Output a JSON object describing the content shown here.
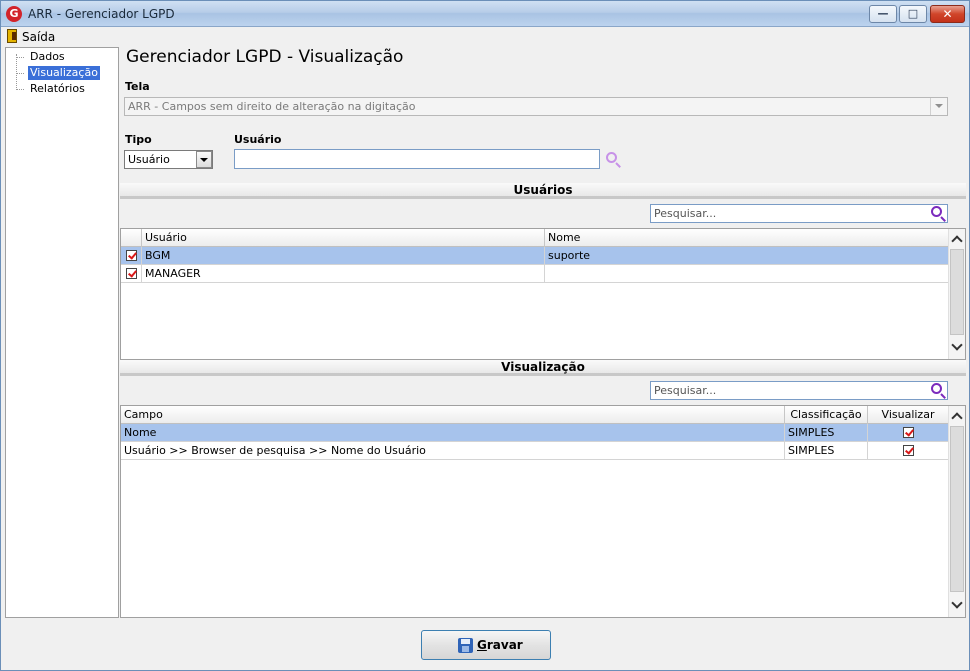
{
  "window": {
    "logo_letter": "G",
    "title": "ARR - Gerenciador LGPD"
  },
  "menu": {
    "exit_label": "Saída"
  },
  "tree": {
    "items": [
      {
        "label": "Dados",
        "selected": false
      },
      {
        "label": "Visualização",
        "selected": true
      },
      {
        "label": "Relatórios",
        "selected": false
      }
    ]
  },
  "page": {
    "heading": "Gerenciador LGPD - Visualização",
    "screen_label": "Tela",
    "screen_value": "ARR - Campos sem direito de alteração na digitação",
    "type_label": "Tipo",
    "type_value": "Usuário",
    "user_label": "Usuário",
    "user_value": ""
  },
  "users_section": {
    "title": "Usuários",
    "search_placeholder": "Pesquisar...",
    "columns": {
      "user": "Usuário",
      "name": "Nome"
    },
    "rows": [
      {
        "checked": true,
        "user": "BGM",
        "name": "suporte",
        "selected": true
      },
      {
        "checked": true,
        "user": "MANAGER",
        "name": "",
        "selected": false
      }
    ]
  },
  "view_section": {
    "title": "Visualização",
    "search_placeholder": "Pesquisar...",
    "columns": {
      "field": "Campo",
      "classification": "Classificação",
      "view": "Visualizar"
    },
    "rows": [
      {
        "field": "Nome",
        "classification": "SIMPLES",
        "view": true,
        "selected": true
      },
      {
        "field": "Usuário >> Browser de pesquisa >> Nome do Usuário",
        "classification": "SIMPLES",
        "view": true,
        "selected": false
      }
    ]
  },
  "actions": {
    "save_label": "Gravar"
  },
  "colors": {
    "selection": "#a7c3ec",
    "tree_selection": "#3a6fd8",
    "accent_search": "#7b2bbd",
    "check": "#d81818"
  }
}
